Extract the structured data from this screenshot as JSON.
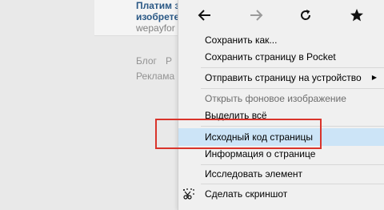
{
  "background": {
    "ad_title_line1": "Платим з",
    "ad_title_line2": "изобрете",
    "ad_domain": "wepayfor",
    "footer_blog": "Блог",
    "footer_fragment": "Р",
    "footer_ads": "Реклама"
  },
  "nav": {
    "back_icon": "back-arrow-icon",
    "forward_icon": "forward-arrow-icon",
    "reload_icon": "reload-icon",
    "bookmark_icon": "star-icon"
  },
  "menu": {
    "save_as": "Сохранить как...",
    "save_pocket": "Сохранить страницу в Pocket",
    "send_device": "Отправить страницу на устройство",
    "open_bg_image": "Открыть фоновое изображение",
    "select_all": "Выделить всё",
    "view_source": "Исходный код страницы",
    "page_info": "Информация о странице",
    "inspect": "Исследовать элемент",
    "screenshot": "Сделать скриншот"
  },
  "colors": {
    "highlight": "#cce4f7",
    "annotation_box": "#d9342b",
    "link": "#2a5885"
  }
}
